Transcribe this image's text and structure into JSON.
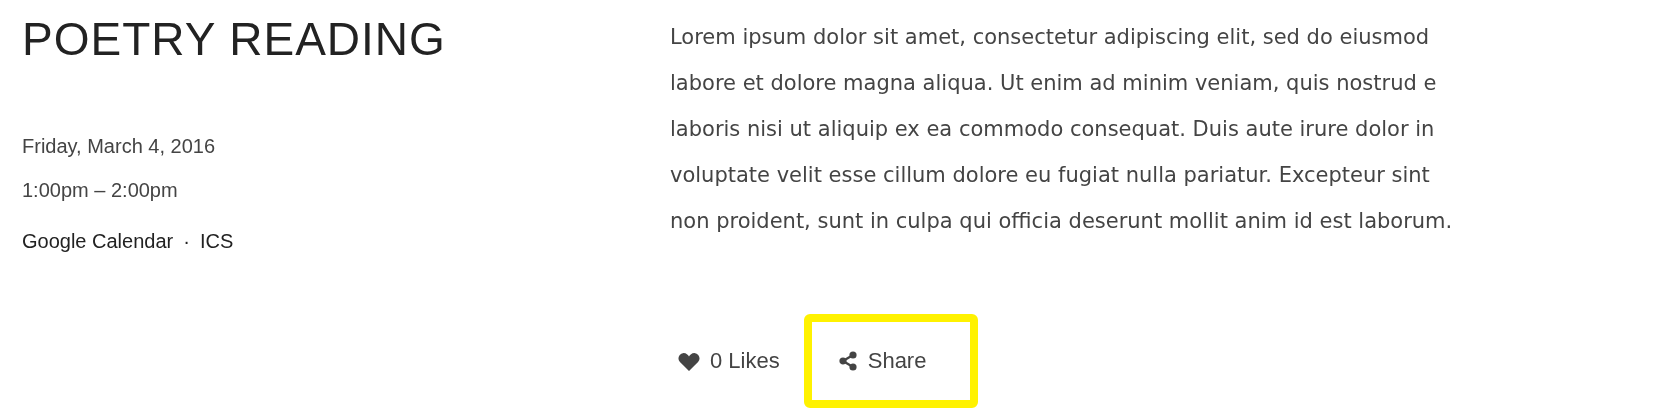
{
  "event": {
    "title": "POETRY READING",
    "date": "Friday, March 4, 2016",
    "time": "1:00pm – 2:00pm",
    "calendar_links": [
      {
        "label": "Google Calendar"
      },
      {
        "label": "ICS"
      }
    ],
    "separator": "·"
  },
  "description_lines": [
    "Lorem ipsum dolor sit amet, consectetur adipiscing elit, sed do eiusmod",
    "labore et dolore magna aliqua. Ut enim ad minim veniam, quis nostrud e",
    "laboris nisi ut aliquip ex ea commodo consequat. Duis aute irure dolor in",
    "voluptate velit esse cillum dolore eu fugiat nulla pariatur. Excepteur sint",
    "non proident, sunt in culpa qui officia deserunt mollit anim id est laborum."
  ],
  "actions": {
    "likes": "0 Likes",
    "share": {
      "label": "Share",
      "highlighted": true
    }
  }
}
